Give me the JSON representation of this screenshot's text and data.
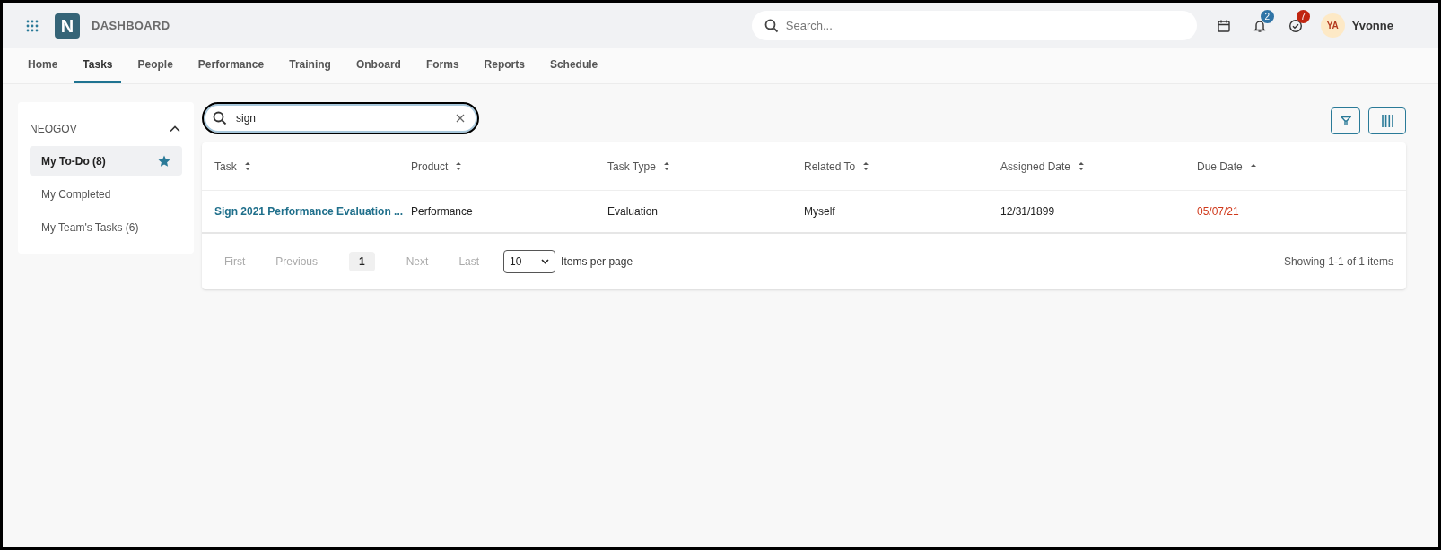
{
  "header": {
    "logo": "N",
    "title": "DASHBOARD",
    "search": {
      "placeholder": "Search..."
    },
    "notifications": "2",
    "tasks": "7",
    "user": {
      "initials": "YA",
      "name": "Yvonne"
    }
  },
  "nav": [
    {
      "label": "Home",
      "selected": false
    },
    {
      "label": "Tasks",
      "selected": true
    },
    {
      "label": "People",
      "selected": false
    },
    {
      "label": "Performance",
      "selected": false
    },
    {
      "label": "Training",
      "selected": false
    },
    {
      "label": "Onboard",
      "selected": false
    },
    {
      "label": "Forms",
      "selected": false
    },
    {
      "label": "Reports",
      "selected": false
    },
    {
      "label": "Schedule",
      "selected": false
    }
  ],
  "sidebar": {
    "title": "NEOGOV",
    "expanded": true,
    "items": [
      {
        "label": "My To-Do (8)",
        "selected": true,
        "starred": true
      },
      {
        "label": "My Completed",
        "selected": false,
        "starred": false
      },
      {
        "label": "My Team's Tasks (6)",
        "selected": false,
        "starred": false
      }
    ]
  },
  "filter_search": {
    "value": "sign"
  },
  "table": {
    "columns": [
      {
        "label": "Task",
        "sorted": false
      },
      {
        "label": "Product",
        "sorted": false
      },
      {
        "label": "Task Type",
        "sorted": false
      },
      {
        "label": "Related To",
        "sorted": false
      },
      {
        "label": "Assigned Date",
        "sorted": false
      },
      {
        "label": "Due Date",
        "sorted": true
      }
    ],
    "rows": [
      {
        "cells": [
          {
            "kind": "link",
            "text": "Sign 2021 Performance Evaluation ..."
          },
          {
            "kind": "text",
            "text": "Performance"
          },
          {
            "kind": "text",
            "text": "Evaluation"
          },
          {
            "kind": "text",
            "text": "Myself"
          },
          {
            "kind": "text",
            "text": "12/31/1899"
          },
          {
            "kind": "overdue",
            "text": "05/07/21"
          }
        ]
      }
    ]
  },
  "pagination": {
    "buttons": [
      {
        "label": "First",
        "selected": false
      },
      {
        "label": "Previous",
        "selected": false
      },
      {
        "label": "1",
        "selected": true
      },
      {
        "label": "Next",
        "selected": false
      },
      {
        "label": "Last",
        "selected": false
      }
    ],
    "page_size": "10",
    "page_size_label": "Items per page",
    "summary": "Showing 1-1 of 1 items"
  }
}
